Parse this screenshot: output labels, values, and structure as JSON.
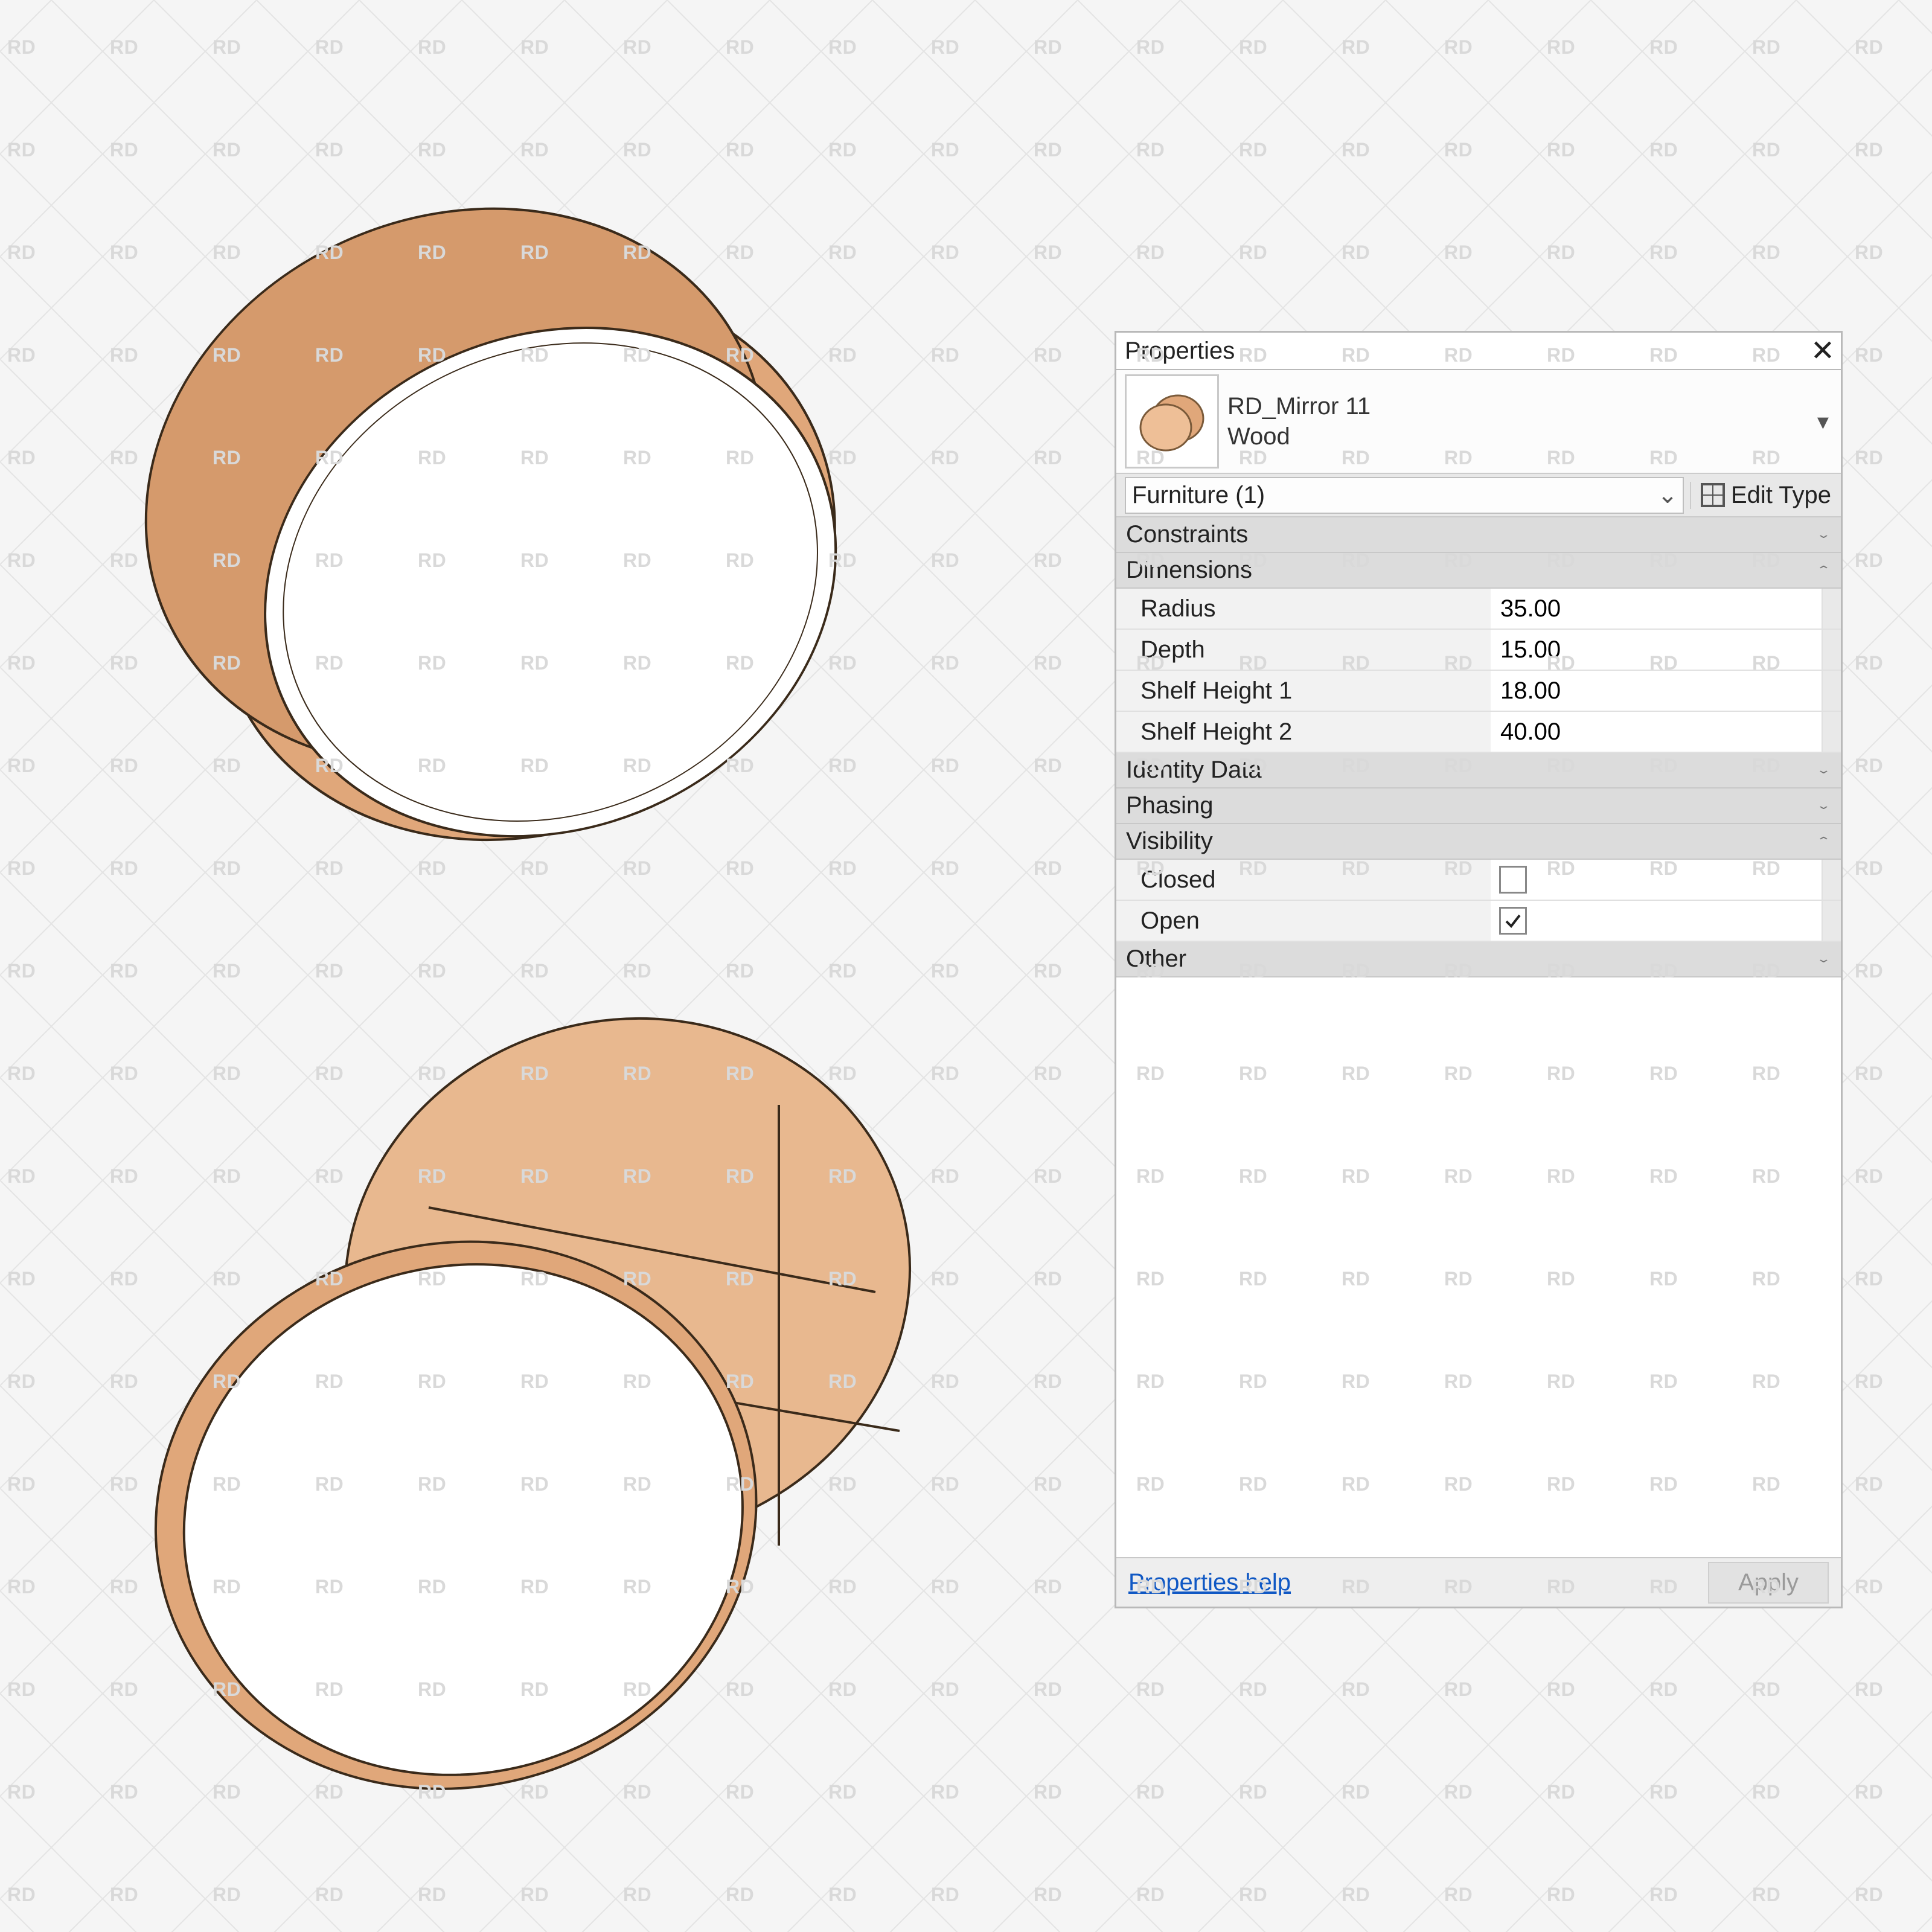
{
  "watermark": "RD",
  "panel": {
    "title": "Properties",
    "type_name": "RD_Mirror 11",
    "type_sub": "Wood",
    "selector": "Furniture (1)",
    "edit_type": "Edit Type",
    "categories": {
      "constraints": "Constraints",
      "dimensions": "Dimensions",
      "identity": "Identity Data",
      "phasing": "Phasing",
      "visibility": "Visibility",
      "other": "Other"
    },
    "dimensions": {
      "radius_label": "Radius",
      "radius_value": "35.00",
      "depth_label": "Depth",
      "depth_value": "15.00",
      "sh1_label": "Shelf Height 1",
      "sh1_value": "18.00",
      "sh2_label": "Shelf Height 2",
      "sh2_value": "40.00"
    },
    "visibility": {
      "closed_label": "Closed",
      "closed_checked": false,
      "open_label": "Open",
      "open_checked": true
    },
    "help": "Properties help",
    "apply": "Apply"
  }
}
